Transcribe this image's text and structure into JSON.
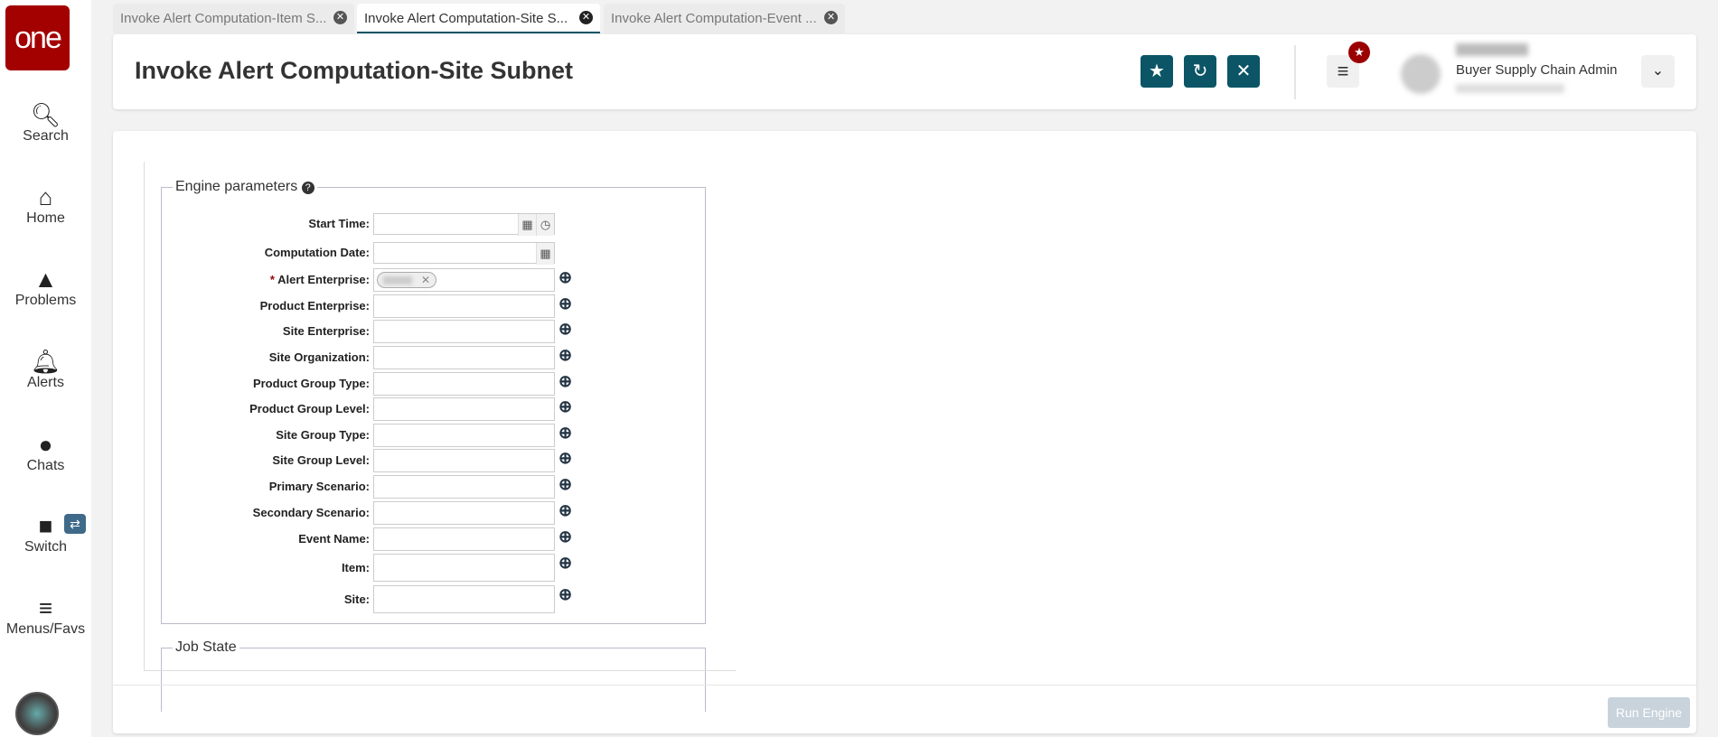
{
  "sidebar": {
    "logo": "one",
    "items": [
      {
        "label": "Search",
        "icon": "search-icon"
      },
      {
        "label": "Home",
        "icon": "home-icon"
      },
      {
        "label": "Problems",
        "icon": "warning-icon"
      },
      {
        "label": "Alerts",
        "icon": "bell-icon"
      },
      {
        "label": "Chats",
        "icon": "chat-icon"
      },
      {
        "label": "Switch",
        "icon": "switch-icon"
      },
      {
        "label": "Menus/Favs",
        "icon": "menu-icon"
      }
    ]
  },
  "tabs": [
    {
      "label": "Invoke Alert Computation-Item S..."
    },
    {
      "label": "Invoke Alert Computation-Site S...",
      "active": true
    },
    {
      "label": "Invoke Alert Computation-Event ..."
    }
  ],
  "header": {
    "title": "Invoke Alert Computation-Site Subnet",
    "role": "Buyer Supply Chain Admin"
  },
  "form": {
    "legend": "Engine parameters",
    "job_state_legend": "Job State",
    "fields": [
      {
        "label": "Start Time:"
      },
      {
        "label": "Computation Date:"
      },
      {
        "label": "Alert Enterprise:",
        "required": true
      },
      {
        "label": "Product Enterprise:"
      },
      {
        "label": "Site Enterprise:"
      },
      {
        "label": "Site Organization:"
      },
      {
        "label": "Product Group Type:"
      },
      {
        "label": "Product Group Level:"
      },
      {
        "label": "Site Group Type:"
      },
      {
        "label": "Site Group Level:"
      },
      {
        "label": "Primary Scenario:"
      },
      {
        "label": "Secondary Scenario:"
      },
      {
        "label": "Event Name:"
      },
      {
        "label": "Item:"
      },
      {
        "label": "Site:"
      }
    ]
  },
  "footer": {
    "run_label": "Run Engine"
  },
  "colors": {
    "brand": "#a30000",
    "accent": "#0b5566"
  }
}
